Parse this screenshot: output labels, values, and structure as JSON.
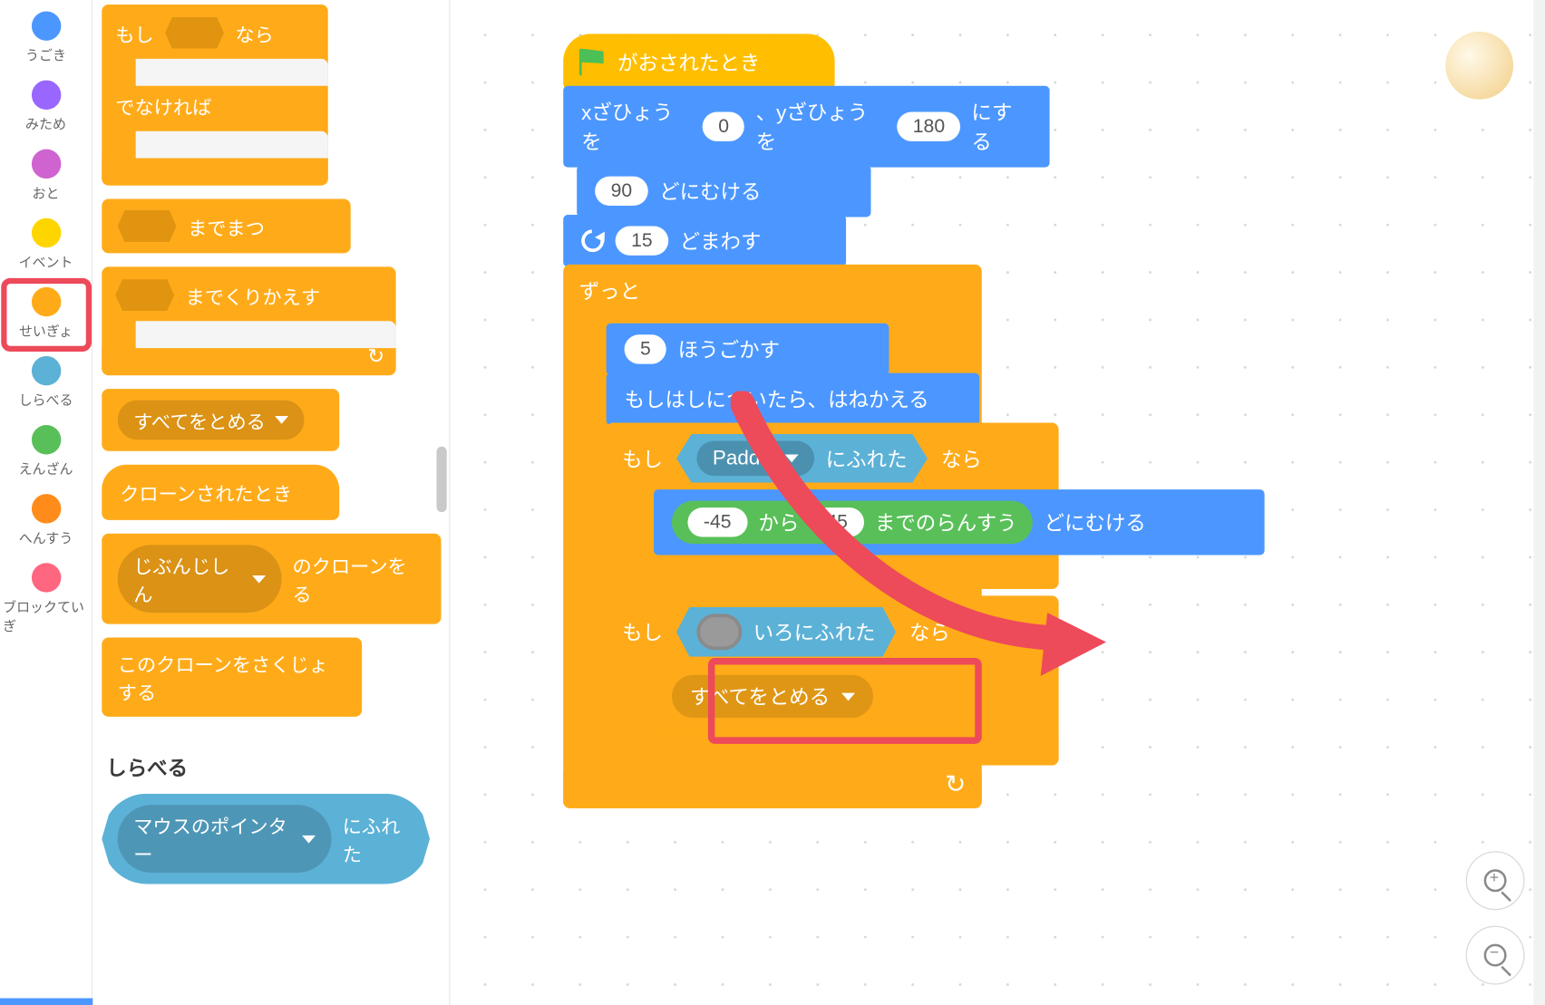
{
  "categories": [
    {
      "id": "motion",
      "label": "うごき"
    },
    {
      "id": "looks",
      "label": "みため"
    },
    {
      "id": "sound",
      "label": "おと"
    },
    {
      "id": "events",
      "label": "イベント"
    },
    {
      "id": "control",
      "label": "せいぎょ",
      "active": true
    },
    {
      "id": "sensing",
      "label": "しらべる"
    },
    {
      "id": "operators",
      "label": "えんざん"
    },
    {
      "id": "variables",
      "label": "へんすう"
    },
    {
      "id": "myblocks",
      "label": "ブロックていぎ"
    }
  ],
  "palette": {
    "if_then_else": {
      "if": "もし",
      "then": "なら",
      "else": "でなければ"
    },
    "wait_until": {
      "suffix": "までまつ"
    },
    "repeat_until": {
      "suffix": "までくりかえす"
    },
    "stop": {
      "option": "すべてをとめる"
    },
    "when_cloned": "クローンされたとき",
    "create_clone": {
      "prefix_option": "じぶんじしん",
      "suffix": "のクローンを    る"
    },
    "delete_clone": "このクローンをさくじょする",
    "sensing_header": "しらべる",
    "touching": {
      "option": "マウスのポインター",
      "suffix": "にふれた"
    }
  },
  "script": {
    "hat": "がおされたとき",
    "goto": {
      "pre_x": "xざひょうを",
      "x": "0",
      "mid": "、yざひょうを",
      "y": "180",
      "suffix": "にする"
    },
    "point": {
      "val": "90",
      "suffix": "どにむける"
    },
    "turn": {
      "val": "15",
      "suffix": "どまわす"
    },
    "forever": "ずっと",
    "move": {
      "val": "5",
      "suffix": "ほうごかす"
    },
    "bounce": "もしはしについたら、はねかえる",
    "if1": {
      "if": "もし",
      "touch_option": "Paddle",
      "touch_suffix": "にふれた",
      "then": "なら"
    },
    "rand": {
      "a": "-45",
      "mid": "から",
      "b": "45",
      "suffix": "までのらんすう"
    },
    "point2_suffix": "どにむける",
    "if2": {
      "if": "もし",
      "color_suffix": "いろにふれた",
      "then": "なら"
    },
    "stop": {
      "option": "すべてをとめる"
    }
  },
  "colors": {
    "motion": "#4c97ff",
    "control": "#ffab19",
    "events": "#ffbf00",
    "sensing": "#5cb1d6",
    "operators": "#59c059",
    "highlight": "#ed4a5a"
  }
}
